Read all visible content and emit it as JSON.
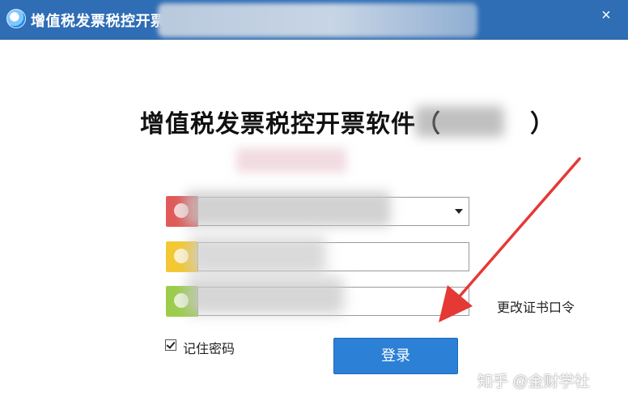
{
  "window": {
    "title": "增值税发票税控开票",
    "close_glyph": "×",
    "title_bar_color": "#2f6db5",
    "app_icon": "app-logo-icon"
  },
  "main": {
    "heading": "增值税发票税控开票软件（",
    "heading_close": "）"
  },
  "form": {
    "user_icon": "user-icon",
    "password_icon": "lock-icon",
    "cert_icon": "key-icon",
    "change_cert_password_label": "更改证书口令",
    "remember_password_label": "记住密码",
    "remember_password_checked": true,
    "login_button_label": "登录",
    "login_button_color": "#2c80d6"
  },
  "annotation": {
    "arrow_color": "#e53935",
    "arrow_icon": "red-arrow-icon"
  },
  "watermark": {
    "text": "知乎 @金财学社"
  }
}
